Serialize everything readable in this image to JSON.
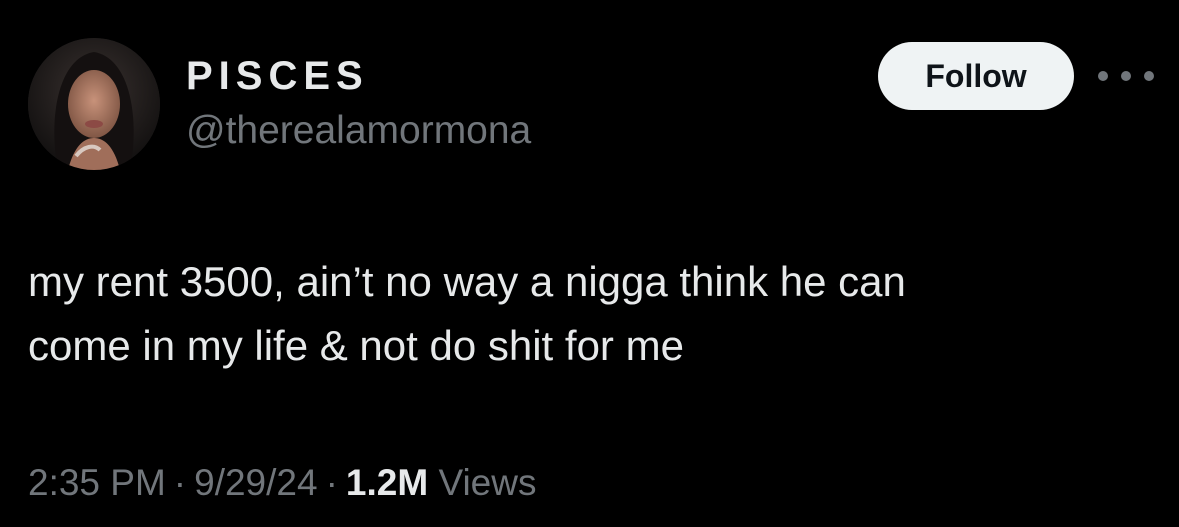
{
  "author": {
    "display_name": "PISCES",
    "handle": "@therealamormona",
    "avatar_icon": "profile-photo"
  },
  "actions": {
    "follow_label": "Follow",
    "more_icon": "more-horizontal-icon"
  },
  "tweet": {
    "lines": [
      "my rent 3500, ain’t no way a nigga think he can",
      "come in my life & not do shit for me"
    ]
  },
  "meta": {
    "time": "2:35 PM",
    "separator": "·",
    "date": "9/29/24",
    "views_count": "1.2M",
    "views_label": "Views"
  },
  "colors": {
    "background": "#000000",
    "primary_text": "#e7e9ea",
    "secondary_text": "#71767b",
    "follow_button_bg": "#eff3f4",
    "follow_button_text": "#0f1419"
  }
}
